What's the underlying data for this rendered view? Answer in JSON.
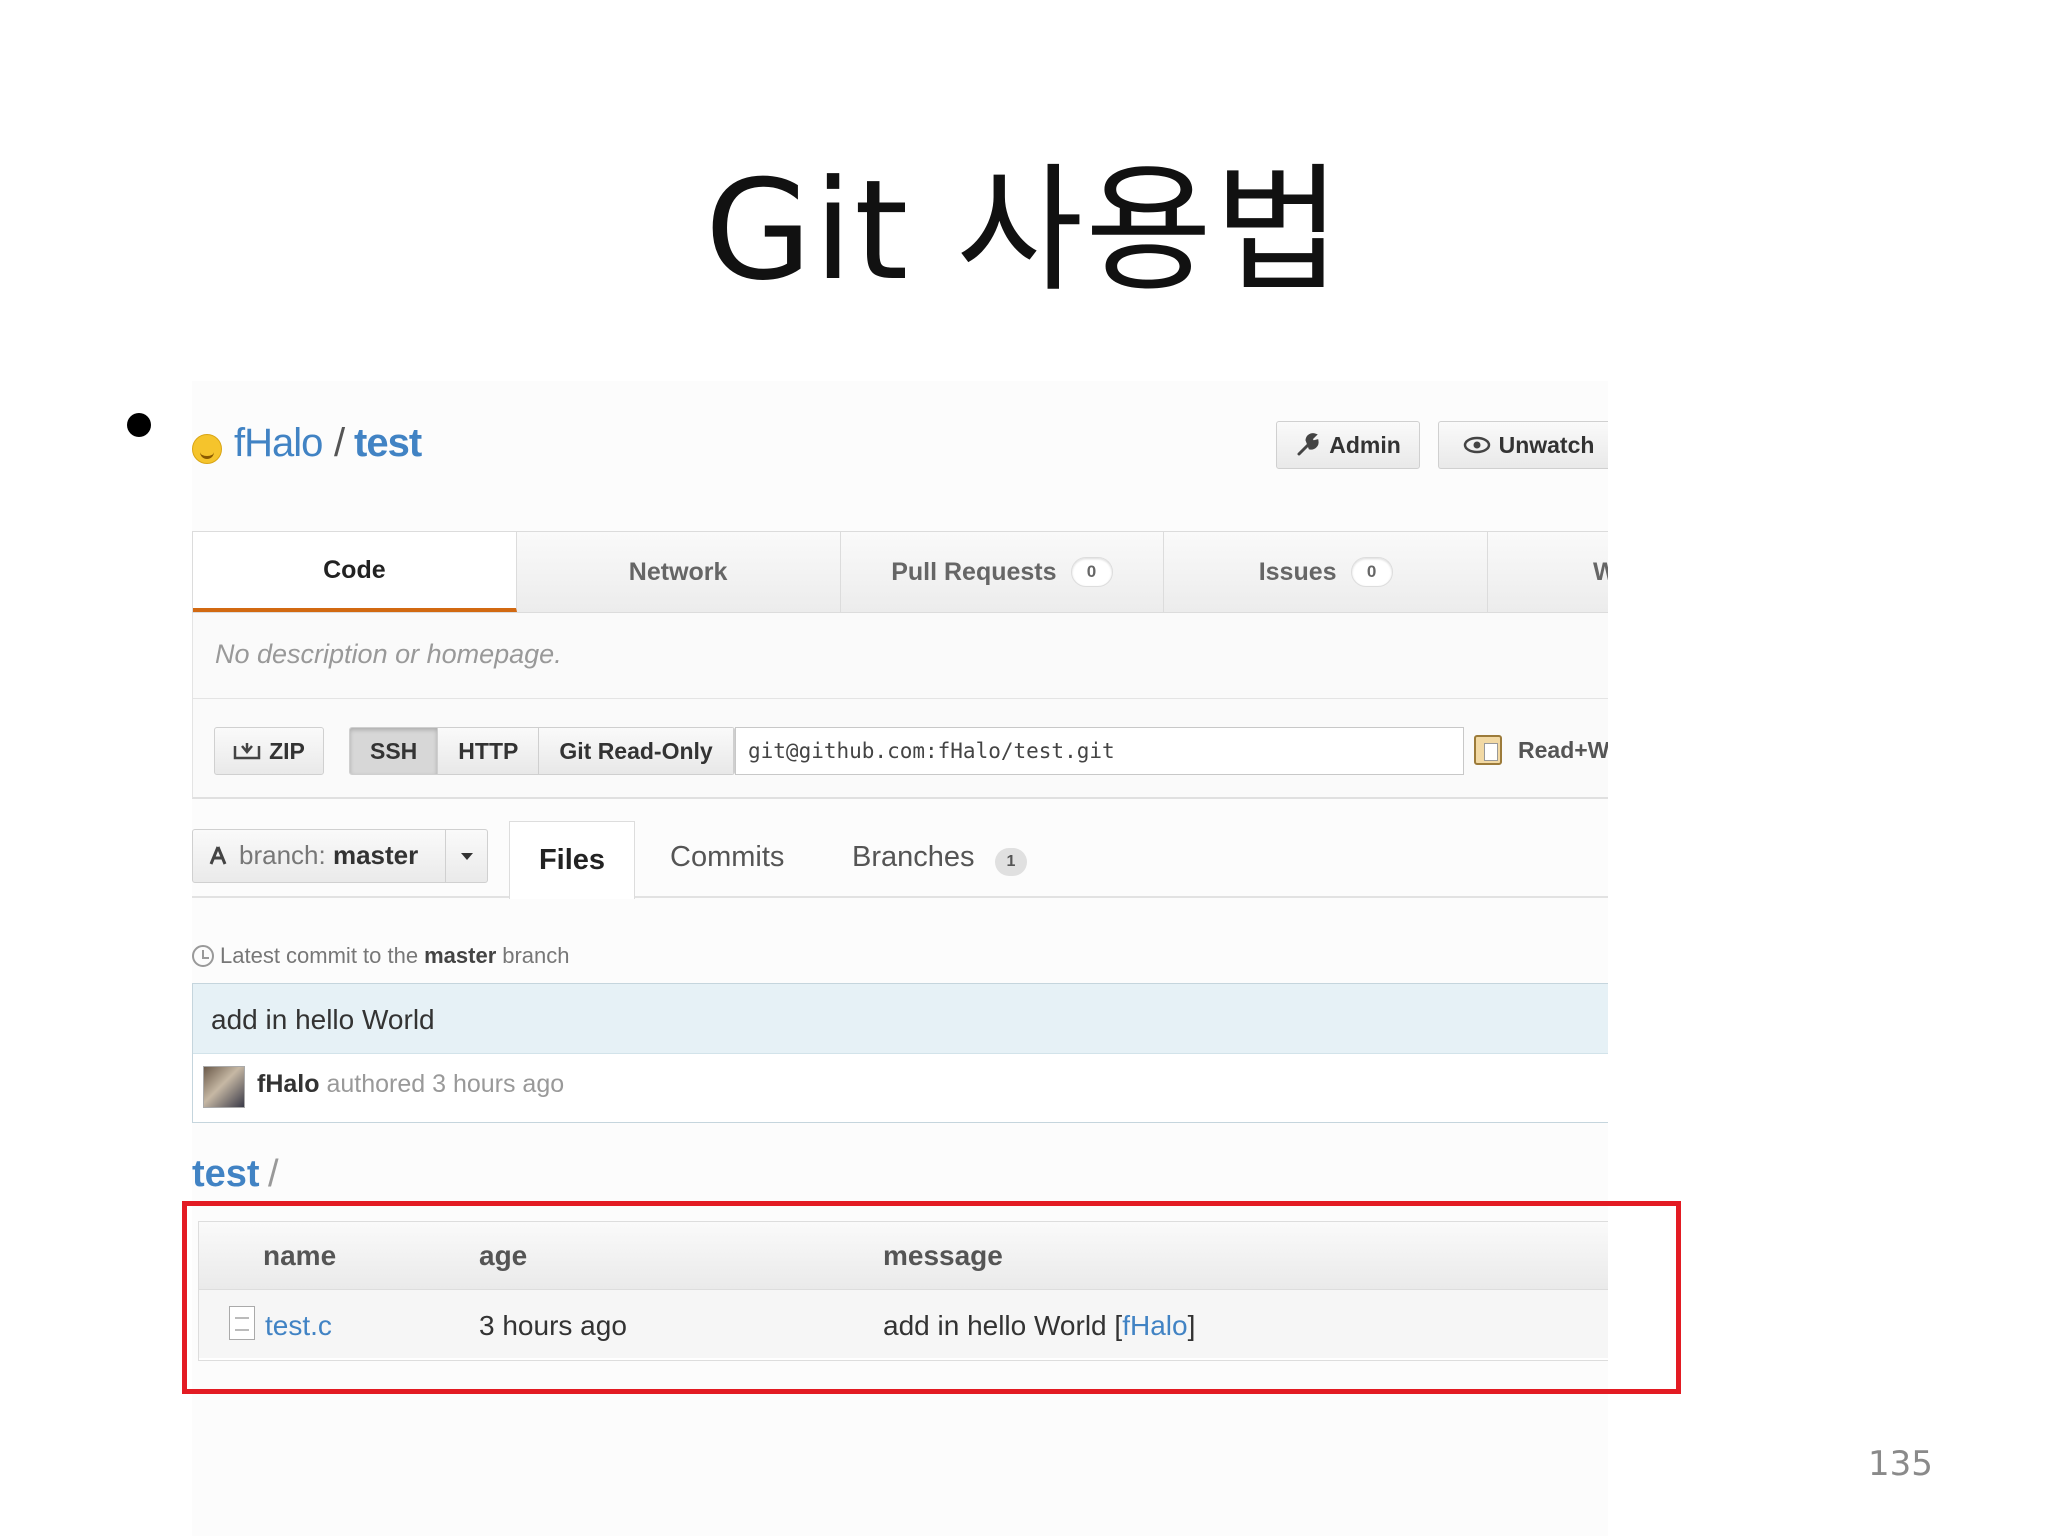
{
  "slide": {
    "title": "Git 사용법",
    "page_number": "135"
  },
  "repo": {
    "owner": "fHalo",
    "separator": "/",
    "name": "test"
  },
  "actions": {
    "admin": "Admin",
    "unwatch": "Unwatch"
  },
  "tabs": [
    {
      "label": "Code",
      "count": null
    },
    {
      "label": "Network",
      "count": null
    },
    {
      "label": "Pull Requests",
      "count": "0"
    },
    {
      "label": "Issues",
      "count": "0"
    },
    {
      "label": "W",
      "count": null
    }
  ],
  "description": "No description or homepage.",
  "clone": {
    "zip": "ZIP",
    "protocols": [
      "SSH",
      "HTTP",
      "Git Read-Only"
    ],
    "selected_protocol": "SSH",
    "url": "git@github.com:fHalo/test.git",
    "access": "Read+W"
  },
  "branch": {
    "prefix": "branch:",
    "name": "master"
  },
  "subtabs": {
    "files": "Files",
    "commits": "Commits",
    "branches": "Branches",
    "branches_count": "1"
  },
  "latest_commit": {
    "label_pre": "Latest commit to the",
    "branch": "master",
    "label_post": "branch",
    "message": "add in hello World",
    "author": "fHalo",
    "authored": "authored 3 hours ago"
  },
  "path": {
    "repo": "test",
    "slash": "/"
  },
  "file_table": {
    "headers": {
      "name": "name",
      "age": "age",
      "message": "message"
    },
    "rows": [
      {
        "name": "test.c",
        "age": "3 hours ago",
        "message": "add in hello World",
        "message_link": "fHalo"
      }
    ]
  },
  "colors": {
    "link": "#4183c4",
    "tab_active_underline": "#d26911",
    "highlight": "#e31b23",
    "commit_bar": "#e6f1f6"
  }
}
